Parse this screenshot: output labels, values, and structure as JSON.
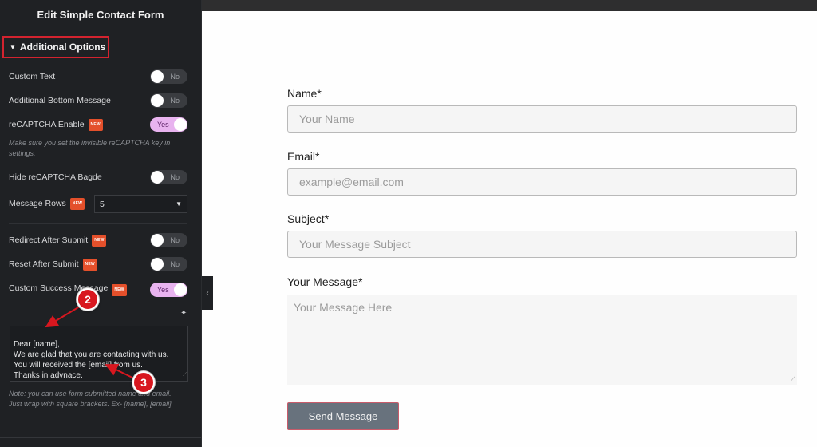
{
  "sidebar": {
    "title": "Edit Simple Contact Form",
    "section_title": "Additional Options",
    "controls": [
      {
        "label": "Custom Text",
        "state": "No",
        "new": false
      },
      {
        "label": "Additional Bottom Message",
        "state": "No",
        "new": false
      },
      {
        "label": "reCAPTCHA Enable",
        "state": "Yes",
        "new": true
      },
      {
        "label": "Hide reCAPTCHA Bagde",
        "state": "No",
        "new": false
      },
      {
        "label": "Message Rows",
        "value": "5",
        "new": true
      },
      {
        "label": "Redirect After Submit",
        "state": "No",
        "new": true
      },
      {
        "label": "Reset After Submit",
        "state": "No",
        "new": true
      },
      {
        "label": "Custom Success Message",
        "state": "Yes",
        "new": true
      }
    ],
    "new_badge": "NEW",
    "recaptcha_hint": "Make sure you set the invisible reCAPTCHA key in settings.",
    "success_message": "Dear [name],\nWe are glad that you are contacting with us.\nYou will received the [email] from us.\nThanks in advnace.",
    "success_note": "Note: you can use form submitted name and email. Just wrap with square brackets. Ex- [name], [email]"
  },
  "annotations": {
    "marker_2": "2",
    "marker_3": "3"
  },
  "form": {
    "name_label": "Name*",
    "name_placeholder": "Your Name",
    "email_label": "Email*",
    "email_placeholder": "example@email.com",
    "subject_label": "Subject*",
    "subject_placeholder": "Your Message Subject",
    "message_label": "Your Message*",
    "message_placeholder": "Your Message Here",
    "submit_label": "Send Message"
  },
  "colors": {
    "highlight": "#d3232f",
    "toggle_on": "#e8b3ef",
    "new_badge": "#e4502b",
    "button": "#68727d"
  }
}
